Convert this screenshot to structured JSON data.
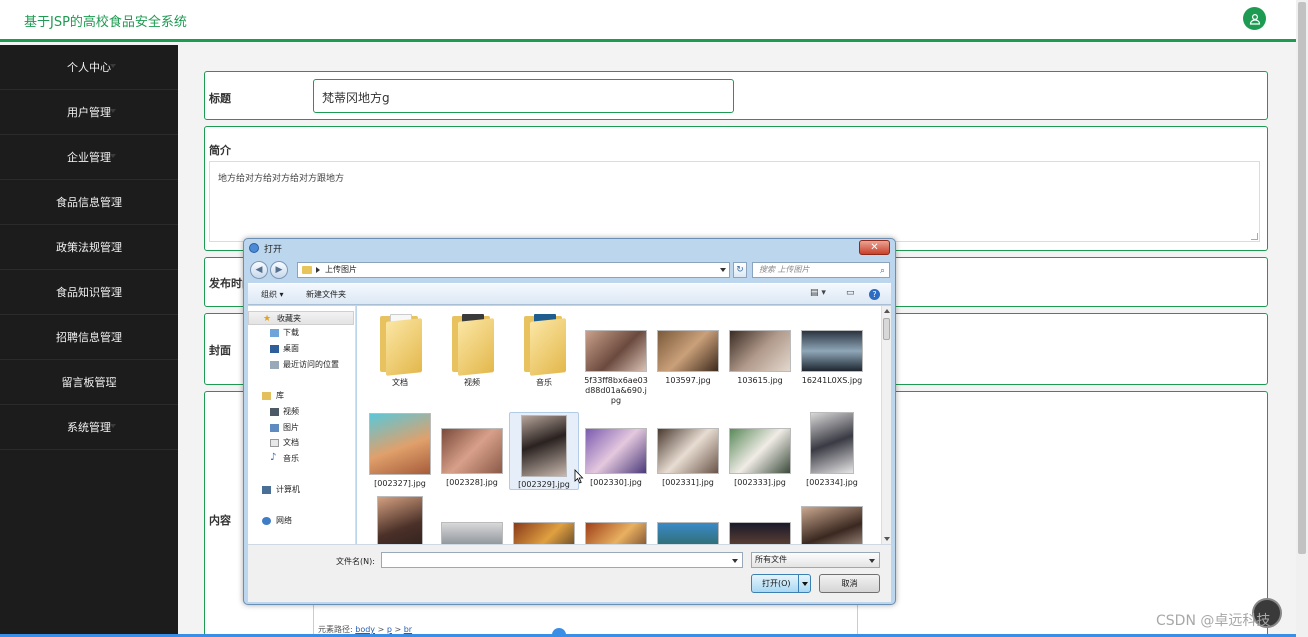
{
  "header": {
    "brand": "基于JSP的高校食品安全系统",
    "user_icon": "user-icon",
    "accent_color": "#1e9b52"
  },
  "sidebar": {
    "items": [
      {
        "label": "个人中心"
      },
      {
        "label": "用户管理"
      },
      {
        "label": "企业管理"
      },
      {
        "label": "食品信息管理"
      },
      {
        "label": "政策法规管理"
      },
      {
        "label": "食品知识管理"
      },
      {
        "label": "招聘信息管理"
      },
      {
        "label": "留言板管理"
      },
      {
        "label": "系统管理"
      }
    ]
  },
  "form": {
    "title_label": "标题",
    "title_value": "梵蒂冈地方g",
    "intro_label": "简介",
    "intro_value": "地方给对方给对方给对方跟地方",
    "publish_label": "发布时间",
    "cover_label": "封面",
    "content_label": "内容",
    "element_path": {
      "prefix": "元素路径:",
      "body": "body",
      "sep1": ">",
      "p": "p",
      "sep2": ">",
      "br": "br"
    }
  },
  "dialog": {
    "title": "打开",
    "close_label": "✕",
    "address": "上传图片",
    "search_placeholder": "搜索 上传图片",
    "organize": "组织 ▾",
    "new_folder": "新建文件夹",
    "nav_groups": {
      "favorites": "收藏夹",
      "downloads": "下载",
      "desktop": "桌面",
      "recent": "最近访问的位置",
      "libraries": "库",
      "videos": "视频",
      "pictures": "图片",
      "documents": "文档",
      "music": "音乐",
      "computer": "计算机",
      "network": "网络"
    },
    "files_row1": [
      {
        "name": "文档",
        "kind": "folder"
      },
      {
        "name": "视频",
        "kind": "folder"
      },
      {
        "name": "音乐",
        "kind": "folder"
      },
      {
        "name": "5f33ff8bx6ae03d88d01a&690.jpg",
        "kind": "image"
      },
      {
        "name": "103597.jpg",
        "kind": "image"
      },
      {
        "name": "103615.jpg",
        "kind": "image"
      },
      {
        "name": "16241L0XS.jpg",
        "kind": "image"
      }
    ],
    "files_row2": [
      {
        "name": "[002327].jpg",
        "kind": "image"
      },
      {
        "name": "[002328].jpg",
        "kind": "image"
      },
      {
        "name": "[002329].jpg",
        "kind": "image"
      },
      {
        "name": "[002330].jpg",
        "kind": "image"
      },
      {
        "name": "[002331].jpg",
        "kind": "image"
      },
      {
        "name": "[002333].jpg",
        "kind": "image"
      },
      {
        "name": "[002334].jpg",
        "kind": "image"
      }
    ],
    "filename_label": "文件名(N):",
    "filename_value": "",
    "filetype": "所有文件",
    "open_label": "打开(O)",
    "cancel_label": "取消"
  },
  "watermark": "CSDN @卓远科技"
}
